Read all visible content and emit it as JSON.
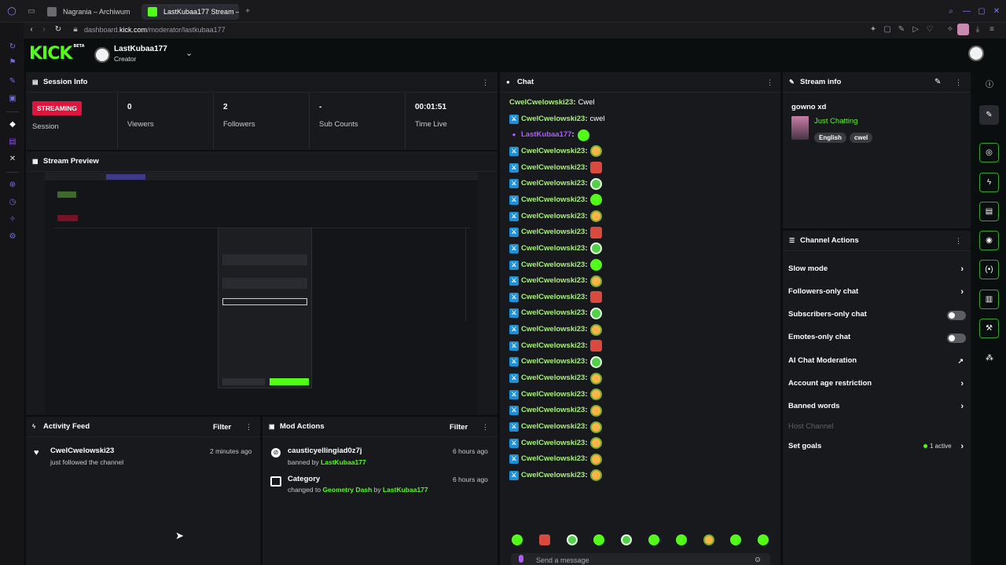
{
  "browser": {
    "tabs": [
      {
        "label": "Nagrania – Archiwum",
        "active": false
      },
      {
        "label": "LastKubaa177 Stream – Ki",
        "active": true
      }
    ],
    "url_prefix": "dashboard.",
    "url_domain": "kick.com",
    "url_path": "/moderator/lastkubaa177"
  },
  "header": {
    "logo": "KICK",
    "logo_tag": "BETA",
    "username": "LastKubaa177",
    "role": "Creator"
  },
  "session_info": {
    "title": "Session Info",
    "status_badge": "STREAMING",
    "session_label": "Session",
    "stats": [
      {
        "value": "0",
        "label": "Viewers"
      },
      {
        "value": "2",
        "label": "Followers"
      },
      {
        "value": "-",
        "label": "Sub Counts"
      },
      {
        "value": "00:01:51",
        "label": "Time Live"
      }
    ]
  },
  "stream_preview": {
    "title": "Stream Preview"
  },
  "activity_feed": {
    "title": "Activity Feed",
    "filter_label": "Filter",
    "items": [
      {
        "user": "CwelCwelowski23",
        "text": "just followed the channel",
        "time": "2 minutes ago"
      }
    ]
  },
  "mod_actions": {
    "title": "Mod Actions",
    "filter_label": "Filter",
    "items": [
      {
        "title": "causticyellingiad0z7j",
        "prefix": "banned by ",
        "actor": "LastKubaa177",
        "time": "6 hours ago"
      },
      {
        "title": "Category",
        "prefix": "changed to ",
        "target": "Geometry Dash",
        "middle": " by ",
        "actor": "LastKubaa177",
        "time": "6 hours ago"
      }
    ]
  },
  "chat": {
    "title": "Chat",
    "messages": [
      {
        "user": "CwelCwelowski23",
        "text": "Cwel",
        "badge": "none",
        "emote": ""
      },
      {
        "user": "CwelCwelowski23",
        "text": "cwel",
        "badge": "mod",
        "emote": ""
      },
      {
        "user": "LastKubaa177",
        "text": "",
        "badge": "broadcaster",
        "emote": "d"
      },
      {
        "user": "CwelCwelowski23",
        "text": "",
        "badge": "mod",
        "emote": "a"
      },
      {
        "user": "CwelCwelowski23",
        "text": "",
        "badge": "mod",
        "emote": "b"
      },
      {
        "user": "CwelCwelowski23",
        "text": "",
        "badge": "mod",
        "emote": "c"
      },
      {
        "user": "CwelCwelowski23",
        "text": "",
        "badge": "mod",
        "emote": "d"
      },
      {
        "user": "CwelCwelowski23",
        "text": "",
        "badge": "mod",
        "emote": "a"
      },
      {
        "user": "CwelCwelowski23",
        "text": "",
        "badge": "mod",
        "emote": "b"
      },
      {
        "user": "CwelCwelowski23",
        "text": "",
        "badge": "mod",
        "emote": "c"
      },
      {
        "user": "CwelCwelowski23",
        "text": "",
        "badge": "mod",
        "emote": "d"
      },
      {
        "user": "CwelCwelowski23",
        "text": "",
        "badge": "mod",
        "emote": "a"
      },
      {
        "user": "CwelCwelowski23",
        "text": "",
        "badge": "mod",
        "emote": "b"
      },
      {
        "user": "CwelCwelowski23",
        "text": "",
        "badge": "mod",
        "emote": "c"
      },
      {
        "user": "CwelCwelowski23",
        "text": "",
        "badge": "mod",
        "emote": "a"
      },
      {
        "user": "CwelCwelowski23",
        "text": "",
        "badge": "mod",
        "emote": "b"
      },
      {
        "user": "CwelCwelowski23",
        "text": "",
        "badge": "mod",
        "emote": "c"
      },
      {
        "user": "CwelCwelowski23",
        "text": "",
        "badge": "mod",
        "emote": "a"
      },
      {
        "user": "CwelCwelowski23",
        "text": "",
        "badge": "mod",
        "emote": "a"
      },
      {
        "user": "CwelCwelowski23",
        "text": "",
        "badge": "mod",
        "emote": "a"
      },
      {
        "user": "CwelCwelowski23",
        "text": "",
        "badge": "mod",
        "emote": "a"
      },
      {
        "user": "CwelCwelowski23",
        "text": "",
        "badge": "mod",
        "emote": "a"
      },
      {
        "user": "CwelCwelowski23",
        "text": "",
        "badge": "mod",
        "emote": "a"
      },
      {
        "user": "CwelCwelowski23",
        "text": "",
        "badge": "mod",
        "emote": "a"
      }
    ],
    "emote_bar": [
      "d",
      "b",
      "c",
      "d",
      "c",
      "d",
      "d",
      "a",
      "d",
      "d"
    ],
    "input_placeholder": "Send a message"
  },
  "stream_info": {
    "title": "Stream info",
    "stream_title": "gowno xd",
    "category": "Just Chatting",
    "tags": [
      "English",
      "cwel"
    ]
  },
  "channel_actions": {
    "title": "Channel Actions",
    "items": [
      {
        "label": "Slow mode",
        "control": "chevron"
      },
      {
        "label": "Followers-only chat",
        "control": "chevron"
      },
      {
        "label": "Subscribers-only chat",
        "control": "toggle"
      },
      {
        "label": "Emotes-only chat",
        "control": "toggle"
      },
      {
        "label": "AI Chat Moderation",
        "control": "external"
      },
      {
        "label": "Account age restriction",
        "control": "chevron"
      },
      {
        "label": "Banned words",
        "control": "chevron"
      },
      {
        "label": "Host Channel",
        "control": "disabled"
      },
      {
        "label": "Set goals",
        "control": "chevron",
        "status": "1 active"
      }
    ]
  },
  "colors": {
    "brand_green": "#53fc18",
    "streaming_red": "#e0143c",
    "mod_blue": "#1d8fd6",
    "chat_user": "#a8f07a",
    "broadcaster": "#b05cff",
    "panel_bg": "#18191c"
  }
}
